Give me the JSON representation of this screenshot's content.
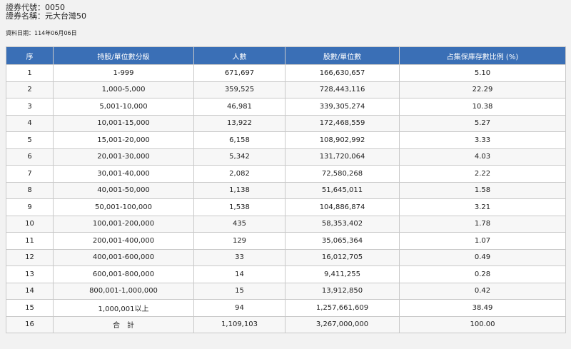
{
  "security": {
    "code_label": "證券代號：",
    "code_value": "0050",
    "name_label": "證券名稱：",
    "name_value": "元大台灣50"
  },
  "data_date": "資料日期：114年06月06日",
  "table": {
    "header_color": "#3a6fb6",
    "columns": [
      "序",
      "持股/單位數分級",
      "人數",
      "股數/單位數",
      "占集保庫存數比例 (%)"
    ],
    "rows": [
      [
        "1",
        "1-999",
        "671,697",
        "166,630,657",
        "5.10"
      ],
      [
        "2",
        "1,000-5,000",
        "359,525",
        "728,443,116",
        "22.29"
      ],
      [
        "3",
        "5,001-10,000",
        "46,981",
        "339,305,274",
        "10.38"
      ],
      [
        "4",
        "10,001-15,000",
        "13,922",
        "172,468,559",
        "5.27"
      ],
      [
        "5",
        "15,001-20,000",
        "6,158",
        "108,902,992",
        "3.33"
      ],
      [
        "6",
        "20,001-30,000",
        "5,342",
        "131,720,064",
        "4.03"
      ],
      [
        "7",
        "30,001-40,000",
        "2,082",
        "72,580,268",
        "2.22"
      ],
      [
        "8",
        "40,001-50,000",
        "1,138",
        "51,645,011",
        "1.58"
      ],
      [
        "9",
        "50,001-100,000",
        "1,538",
        "104,886,874",
        "3.21"
      ],
      [
        "10",
        "100,001-200,000",
        "435",
        "58,353,402",
        "1.78"
      ],
      [
        "11",
        "200,001-400,000",
        "129",
        "35,065,364",
        "1.07"
      ],
      [
        "12",
        "400,001-600,000",
        "33",
        "16,012,705",
        "0.49"
      ],
      [
        "13",
        "600,001-800,000",
        "14",
        "9,411,255",
        "0.28"
      ],
      [
        "14",
        "800,001-1,000,000",
        "15",
        "13,912,850",
        "0.42"
      ],
      [
        "15",
        "1,000,001以上",
        "94",
        "1,257,661,609",
        "38.49"
      ],
      [
        "16",
        "合　計",
        "1,109,103",
        "3,267,000,000",
        "100.00"
      ]
    ]
  }
}
